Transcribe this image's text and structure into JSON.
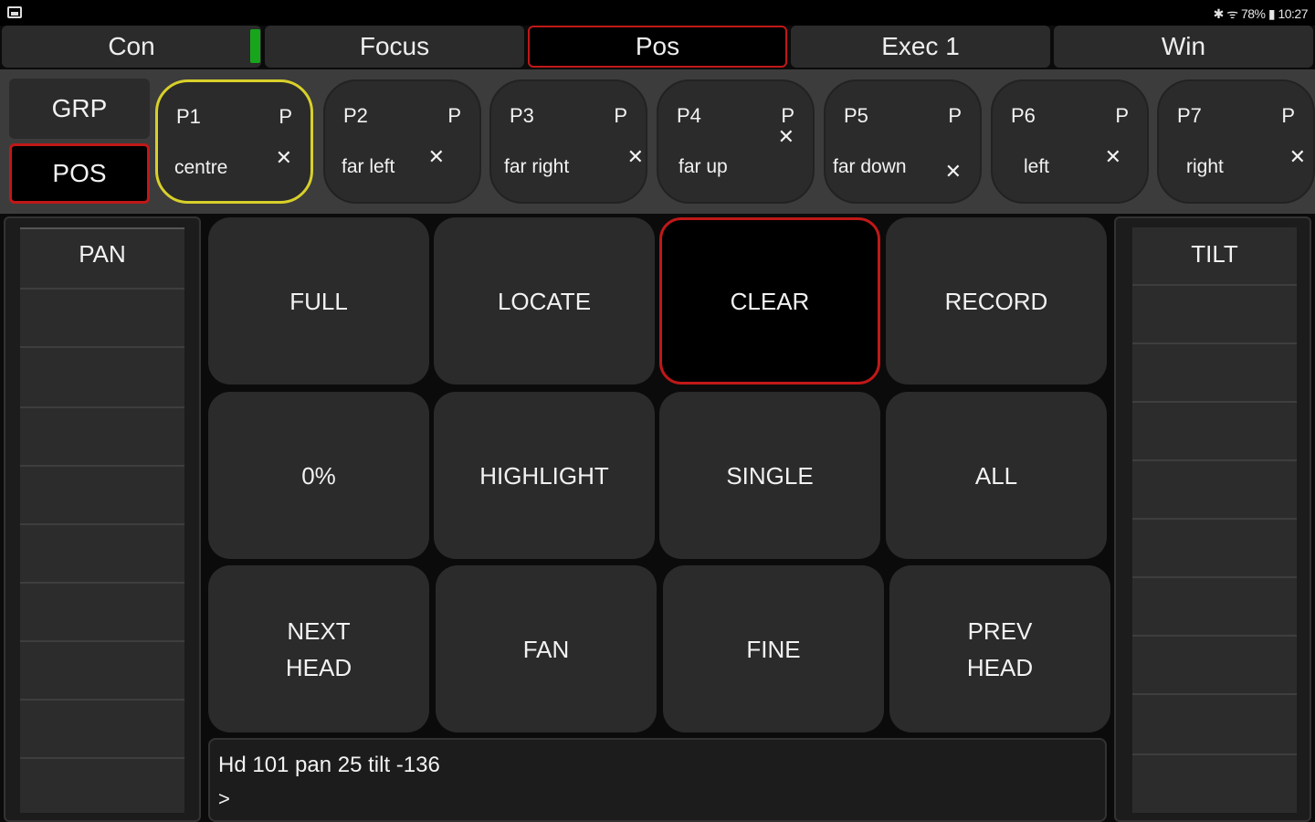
{
  "status_bar": {
    "right_text": "✱ ᯤ 78% ▮ 10:27"
  },
  "tabs": [
    {
      "label": "Con"
    },
    {
      "label": "Focus"
    },
    {
      "label": "Pos"
    },
    {
      "label": "Exec 1"
    },
    {
      "label": "Win"
    }
  ],
  "side_buttons": {
    "grp": "GRP",
    "pos": "POS"
  },
  "palettes": [
    {
      "id": "P1",
      "flag": "P",
      "name": "centre",
      "x": "✕"
    },
    {
      "id": "P2",
      "flag": "P",
      "name": "far left",
      "x": "✕"
    },
    {
      "id": "P3",
      "flag": "P",
      "name": "far right",
      "x": "✕"
    },
    {
      "id": "P4",
      "flag": "P",
      "name": "far up",
      "x": "✕"
    },
    {
      "id": "P5",
      "flag": "P",
      "name": "far down",
      "x": "✕"
    },
    {
      "id": "P6",
      "flag": "P",
      "name": "left",
      "x": "✕"
    },
    {
      "id": "P7",
      "flag": "P",
      "name": "right",
      "x": "✕"
    }
  ],
  "faders": {
    "pan": "PAN",
    "tilt": "TILT"
  },
  "grid": [
    {
      "label": "FULL"
    },
    {
      "label": "LOCATE"
    },
    {
      "label": "CLEAR"
    },
    {
      "label": "RECORD"
    },
    {
      "label": "0%"
    },
    {
      "label": "HIGHLIGHT"
    },
    {
      "label": "SINGLE"
    },
    {
      "label": "ALL"
    },
    {
      "label": "NEXT\nHEAD"
    },
    {
      "label": "FAN"
    },
    {
      "label": "FINE"
    },
    {
      "label": "PREV\nHEAD"
    }
  ],
  "command_line": {
    "line1": "Hd 101 pan 25 tilt -136",
    "line2": ">"
  },
  "colors": {
    "active_border": "#c01818",
    "selected_palette_border": "#d8d02a",
    "indicator_green": "#17a61b"
  }
}
